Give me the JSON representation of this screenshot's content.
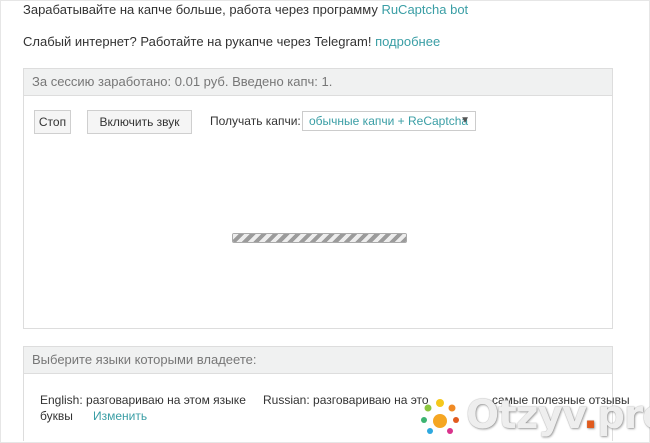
{
  "intro": {
    "line1_text": "Зарабатывайте на капче больше, работа через программу ",
    "line1_link": "RuCaptcha bot",
    "line2_text": "Слабый интернет? Работайте на рукапче через Telegram! ",
    "line2_link": "подробнее"
  },
  "session": {
    "header": "За сессию заработано: 0.01 руб. Введено капч: 1.",
    "stop_label": "Стоп",
    "sound_label": "Включить звук",
    "receive_label": "Получать капчи:",
    "receive_value": "обычные капчи + ReCaptcha",
    "progress_fraction": 1.0
  },
  "languages": {
    "header": "Выберите языки которыми владеете:",
    "english_line1": "English: разговариваю на этом языке",
    "english_line2": "буквы",
    "change_label": "Изменить",
    "russian_line": "Russian: разговариваю на это",
    "right_line": "самые полезные отзывы"
  },
  "watermark": {
    "name": "Otzyv",
    "dot": ".",
    "tld": "pro"
  },
  "colors": {
    "link": "#3a9ea5",
    "panel_header_bg": "#f0f1f1",
    "watermark_accent": "#e15b1e"
  },
  "icons": {
    "dropdown": "triangle-down",
    "watermark_logo": "sparkle-dots"
  }
}
